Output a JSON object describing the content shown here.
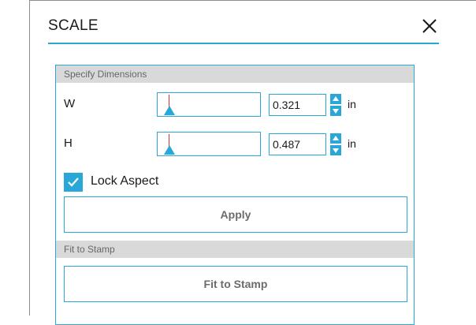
{
  "dialog": {
    "title": "SCALE",
    "accent_color": "#29a8d8",
    "close_icon": "close-icon"
  },
  "specify_dimensions": {
    "header": "Specify Dimensions",
    "width": {
      "label": "W",
      "value": "0.321",
      "unit": "in"
    },
    "height": {
      "label": "H",
      "value": "0.487",
      "unit": "in"
    },
    "lock_aspect": {
      "label": "Lock Aspect",
      "checked": true
    },
    "apply_label": "Apply"
  },
  "fit_to_stamp": {
    "header": "Fit to Stamp",
    "button_label": "Fit to Stamp"
  }
}
